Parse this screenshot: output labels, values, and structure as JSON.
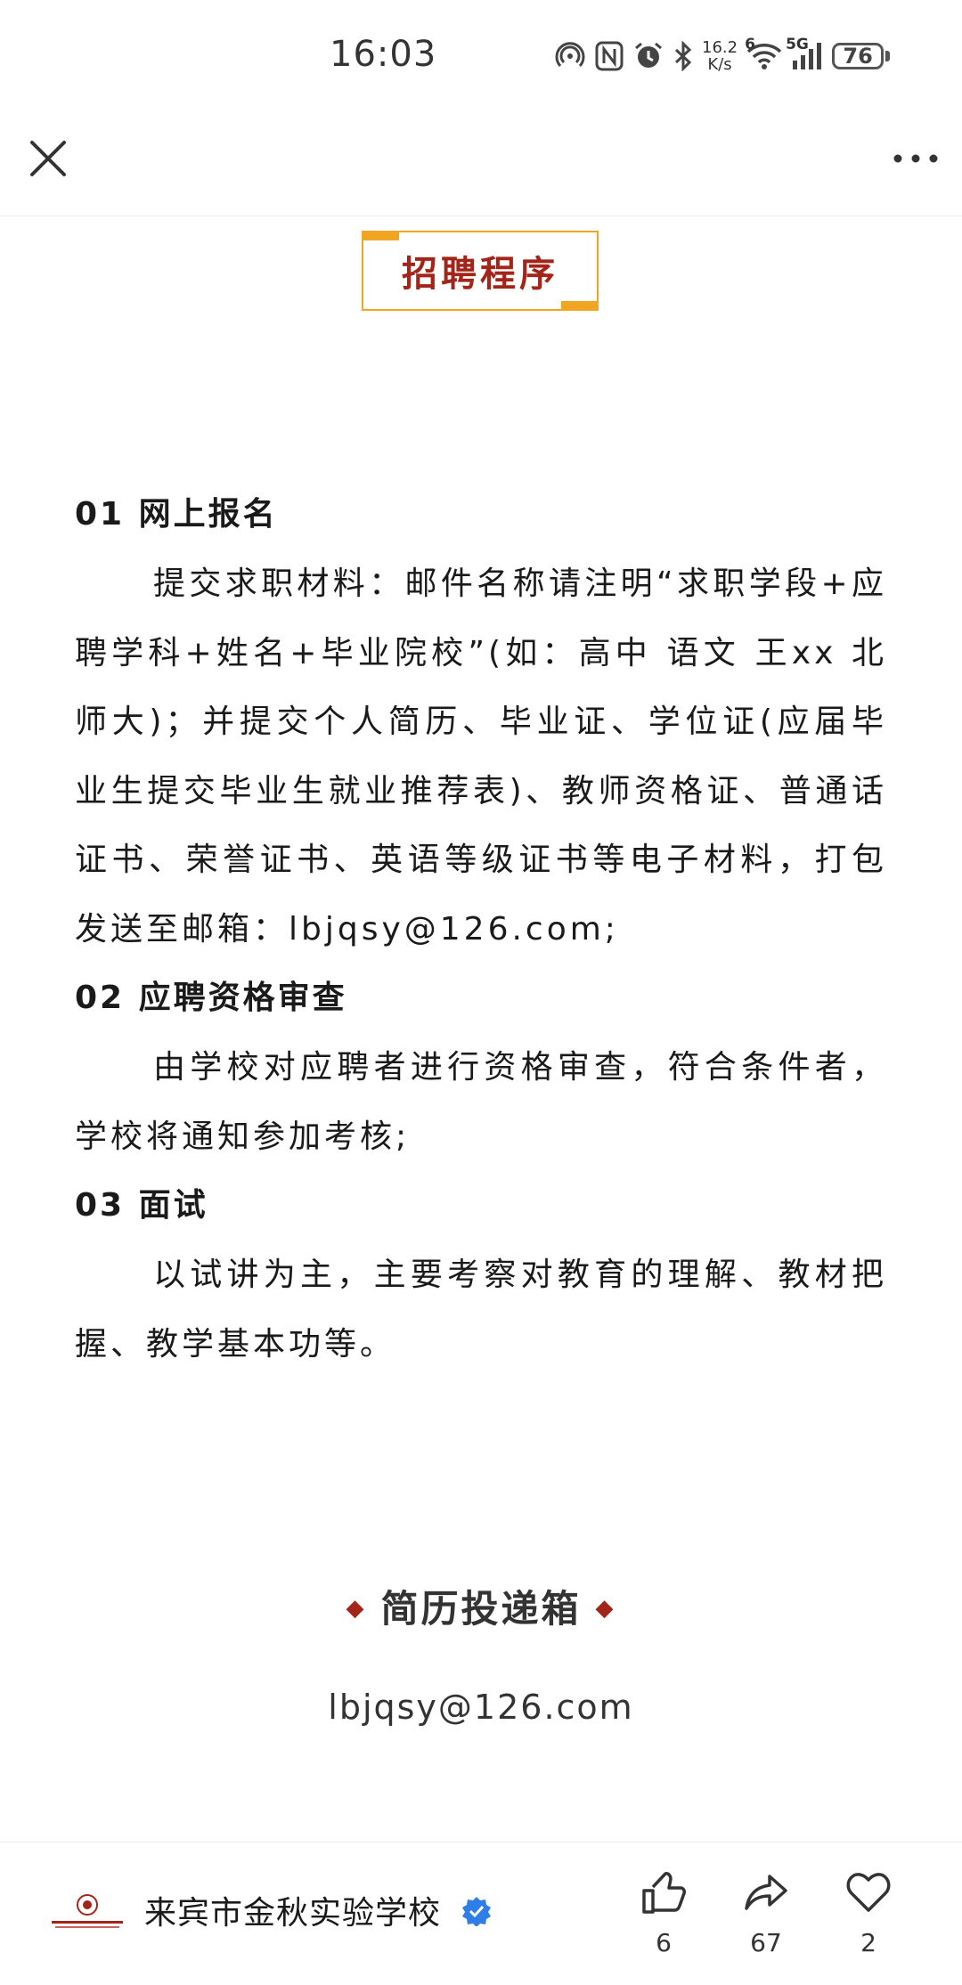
{
  "status_bar": {
    "time": "16:03",
    "net_speed_value": "16.2",
    "net_speed_unit": "K/s",
    "wifi_label": "6",
    "signal_label": "5G",
    "battery": "76",
    "icons": [
      "hotspot-icon",
      "nfc-icon",
      "alarm-icon",
      "bluetooth-icon",
      "wifi-icon",
      "signal-icon",
      "battery-icon"
    ]
  },
  "nav": {
    "close_icon": "close-icon",
    "more_icon": "more-icon"
  },
  "section": {
    "title": "招聘程序"
  },
  "steps": [
    {
      "title": "01 网上报名",
      "body": "提交求职材料：邮件名称请注明“求职学段+应聘学科+姓名+毕业院校”(如：高中 语文 王xx 北师大)；并提交个人简历、毕业证、学位证(应届毕业生提交毕业生就业推荐表)、教师资格证、普通话证书、荣誉证书、英语等级证书等电子材料，打包发送至邮箱：lbjqsy@126.com;"
    },
    {
      "title": "02 应聘资格审查",
      "body": "由学校对应聘者进行资格审查，符合条件者，学校将通知参加考核;"
    },
    {
      "title": "03 面试",
      "body": "以试讲为主，主要考察对教育的理解、教材把握、教学基本功等。"
    }
  ],
  "mailbox": {
    "title": "简历投递箱",
    "email": "lbjqsy@126.com"
  },
  "footer": {
    "school_name": "来宾市金秋实验学校",
    "likes": "6",
    "shares": "67",
    "favorites": "2",
    "accent_color": "#a3251a",
    "verified_color": "#2f7ee8"
  }
}
